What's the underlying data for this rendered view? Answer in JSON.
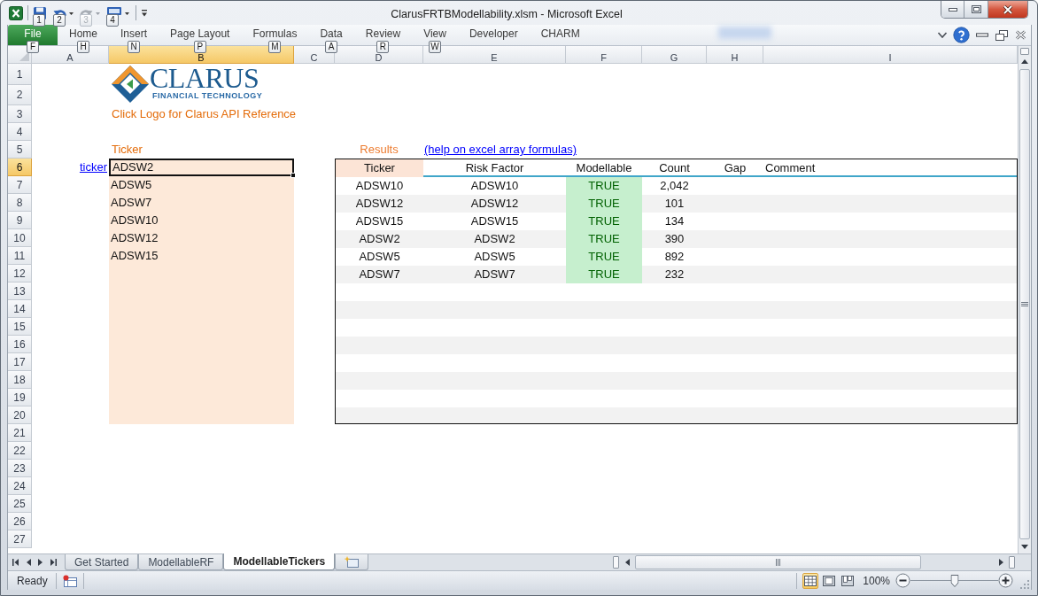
{
  "window": {
    "title": "ClarusFRTBModellability.xlsm - Microsoft Excel"
  },
  "quick_access_toolbar": [
    {
      "key_tip": "1",
      "disabled": false
    },
    {
      "key_tip": "2",
      "disabled": false
    },
    {
      "key_tip": "3",
      "disabled": true
    },
    {
      "key_tip": "4",
      "disabled": false
    }
  ],
  "ribbon_tabs": [
    {
      "label": "File",
      "kind": "file",
      "key_tip": "F"
    },
    {
      "label": "Home",
      "kind": "tab",
      "key_tip": "H"
    },
    {
      "label": "Insert",
      "kind": "tab",
      "key_tip": "N"
    },
    {
      "label": "Page Layout",
      "kind": "tab",
      "key_tip": "P"
    },
    {
      "label": "Formulas",
      "kind": "tab",
      "key_tip": "M"
    },
    {
      "label": "Data",
      "kind": "tab",
      "key_tip": "A"
    },
    {
      "label": "Review",
      "kind": "tab",
      "key_tip": "R"
    },
    {
      "label": "View",
      "kind": "tab",
      "key_tip": "W"
    },
    {
      "label": "Developer",
      "kind": "tab"
    },
    {
      "label": "CHARM",
      "kind": "tab"
    }
  ],
  "column_headers": [
    {
      "label": "A",
      "selected": false
    },
    {
      "label": "B",
      "selected": true
    },
    {
      "label": "C",
      "selected": false
    },
    {
      "label": "D",
      "selected": false
    },
    {
      "label": "E",
      "selected": false
    },
    {
      "label": "F",
      "selected": false
    },
    {
      "label": "G",
      "selected": false
    },
    {
      "label": "H",
      "selected": false
    },
    {
      "label": "I",
      "selected": false
    }
  ],
  "row_headers": [
    {
      "label": "1",
      "selected": false
    },
    {
      "label": "2",
      "selected": false
    },
    {
      "label": "3",
      "selected": false
    },
    {
      "label": "4",
      "selected": false
    },
    {
      "label": "5",
      "selected": false
    },
    {
      "label": "6",
      "selected": true
    },
    {
      "label": "7",
      "selected": false
    },
    {
      "label": "8",
      "selected": false
    },
    {
      "label": "9",
      "selected": false
    },
    {
      "label": "10",
      "selected": false
    },
    {
      "label": "11",
      "selected": false
    },
    {
      "label": "12",
      "selected": false
    },
    {
      "label": "13",
      "selected": false
    },
    {
      "label": "14",
      "selected": false
    },
    {
      "label": "15",
      "selected": false
    },
    {
      "label": "16",
      "selected": false
    },
    {
      "label": "17",
      "selected": false
    },
    {
      "label": "18",
      "selected": false
    },
    {
      "label": "19",
      "selected": false
    },
    {
      "label": "20",
      "selected": false
    },
    {
      "label": "21",
      "selected": false
    },
    {
      "label": "22",
      "selected": false
    },
    {
      "label": "23",
      "selected": false
    },
    {
      "label": "24",
      "selected": false
    },
    {
      "label": "25",
      "selected": false
    },
    {
      "label": "26",
      "selected": false
    },
    {
      "label": "27",
      "selected": false
    }
  ],
  "sheet": {
    "logo": {
      "wordmark": "CLARUS",
      "tagline": "FINANCIAL TECHNOLOGY"
    },
    "logo_note": "Click Logo for Clarus API Reference",
    "ticker_input": {
      "label": "Ticker",
      "link": "ticker",
      "values": [
        {
          "text": "ADSW2",
          "selected": true
        },
        {
          "text": "ADSW5",
          "selected": false
        },
        {
          "text": "ADSW7",
          "selected": false
        },
        {
          "text": "ADSW10",
          "selected": false
        },
        {
          "text": "ADSW12",
          "selected": false
        },
        {
          "text": "ADSW15",
          "selected": false
        }
      ]
    },
    "results": {
      "title": "Results",
      "help_link": "(help on excel array formulas)",
      "columns": [
        {
          "label": "Ticker",
          "shaded": true
        },
        {
          "label": "Risk Factor",
          "shaded": false
        },
        {
          "label": "Modellable",
          "shaded": false
        },
        {
          "label": "Count",
          "shaded": false
        },
        {
          "label": "Gap",
          "shaded": false
        },
        {
          "label": "Comment",
          "shaded": false
        }
      ],
      "rows": [
        {
          "ticker": "ADSW10",
          "risk_factor": "ADSW10",
          "modellable": "TRUE",
          "highlighted": true,
          "count": "2,042"
        },
        {
          "ticker": "ADSW12",
          "risk_factor": "ADSW12",
          "modellable": "TRUE",
          "highlighted": true,
          "count": "101"
        },
        {
          "ticker": "ADSW15",
          "risk_factor": "ADSW15",
          "modellable": "TRUE",
          "highlighted": true,
          "count": "134"
        },
        {
          "ticker": "ADSW2",
          "risk_factor": "ADSW2",
          "modellable": "TRUE",
          "highlighted": true,
          "count": "390"
        },
        {
          "ticker": "ADSW5",
          "risk_factor": "ADSW5",
          "modellable": "TRUE",
          "highlighted": true,
          "count": "892"
        },
        {
          "ticker": "ADSW7",
          "risk_factor": "ADSW7",
          "modellable": "TRUE",
          "highlighted": true,
          "count": "232"
        }
      ]
    }
  },
  "sheet_tabs": [
    {
      "label": "Get Started",
      "selected": false
    },
    {
      "label": "ModellableRF",
      "selected": false
    },
    {
      "label": "ModellableTickers",
      "selected": true
    }
  ],
  "status_bar": {
    "status": "Ready",
    "views": [
      {
        "kind": "normal",
        "selected": true
      },
      {
        "kind": "page_layout",
        "selected": false
      },
      {
        "kind": "page_break",
        "selected": false
      }
    ],
    "zoom": "100%",
    "zoom_slider": {
      "level": 0.5
    }
  }
}
